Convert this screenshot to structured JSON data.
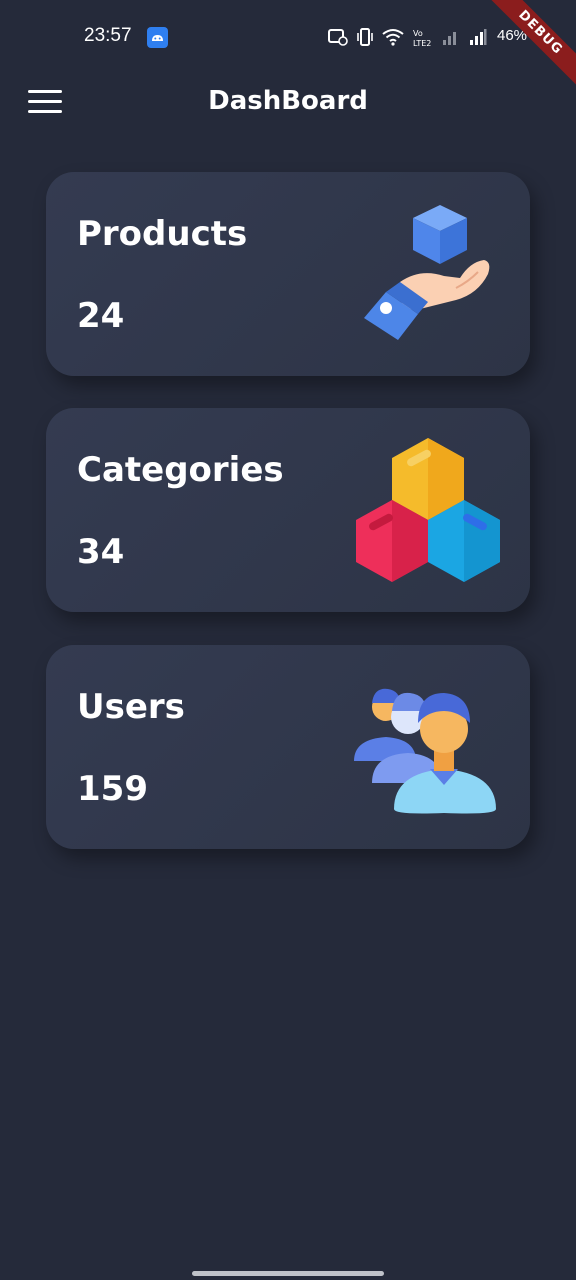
{
  "status_bar": {
    "time": "23:57",
    "battery": "46%",
    "icons": [
      "android-icon",
      "nfc-icon",
      "vibrate-icon",
      "wifi-icon",
      "volte-icon",
      "signal-icon",
      "signal-icon"
    ]
  },
  "debug_banner": "DEBUG",
  "app_bar": {
    "title": "DashBoard",
    "menu_icon": "hamburger-menu-icon"
  },
  "cards": [
    {
      "title": "Products",
      "count": "24",
      "icon": "hand-holding-box-icon"
    },
    {
      "title": "Categories",
      "count": "34",
      "icon": "hexagon-boxes-icon"
    },
    {
      "title": "Users",
      "count": "159",
      "icon": "users-group-icon"
    }
  ],
  "colors": {
    "background": "#252a3a",
    "card": "#323a4f",
    "text": "#ffffff"
  }
}
